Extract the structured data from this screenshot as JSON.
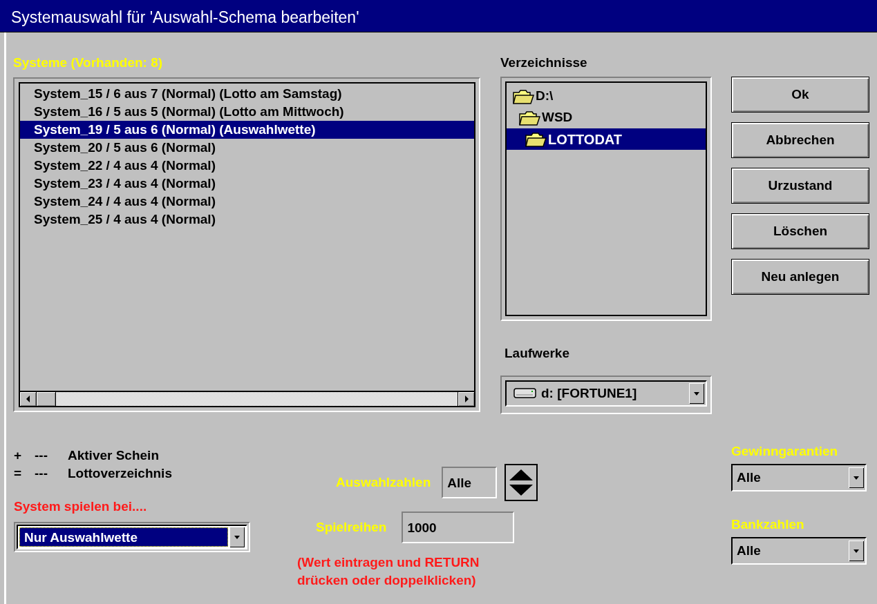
{
  "window": {
    "title": "Systemauswahl für 'Auswahl-Schema bearbeiten'"
  },
  "systems": {
    "label": "Systeme (Vorhanden: 8)",
    "items": [
      {
        "text": "System_15 / 6 aus 7 (Normal) (Lotto am Samstag)",
        "selected": false
      },
      {
        "text": "System_16 / 5 aus 5 (Normal) (Lotto am Mittwoch)",
        "selected": false
      },
      {
        "text": "System_19 / 5 aus 6 (Normal) (Auswahlwette)",
        "selected": true
      },
      {
        "text": "System_20 / 5 aus 6 (Normal)",
        "selected": false
      },
      {
        "text": "System_22 / 4 aus 4 (Normal)",
        "selected": false
      },
      {
        "text": "System_23 / 4 aus 4 (Normal)",
        "selected": false
      },
      {
        "text": "System_24 / 4 aus 4 (Normal)",
        "selected": false
      },
      {
        "text": "System_25 / 4 aus 4 (Normal)",
        "selected": false
      }
    ]
  },
  "directories": {
    "label": "Verzeichnisse",
    "tree": [
      {
        "name": "D:\\",
        "selected": false,
        "children": [
          {
            "name": "WSD",
            "selected": false,
            "children": [
              {
                "name": "LOTTODAT",
                "selected": true
              }
            ]
          }
        ]
      }
    ]
  },
  "drives": {
    "label": "Laufwerke",
    "value": "d: [FORTUNE1]"
  },
  "buttons": [
    "Ok",
    "Abbrechen",
    "Urzustand",
    "Löschen",
    "Neu anlegen"
  ],
  "legend": [
    {
      "symbol": "+",
      "dash": "---",
      "text": "Aktiver Schein"
    },
    {
      "symbol": "=",
      "dash": "---",
      "text": "Lottoverzeichnis"
    }
  ],
  "play_mode": {
    "label": "System spielen bei....",
    "value": "Nur Auswahlwette",
    "focused": true
  },
  "selection_numbers": {
    "label": "Auswahlzahlen",
    "value": "Alle"
  },
  "game_rows": {
    "label": "Spielreihen",
    "value": "1000"
  },
  "hint": [
    "(Wert eintragen und RETURN",
    "drücken oder doppelklicken)"
  ],
  "win_guarantees": {
    "label": "Gewinngarantien",
    "value": "Alle"
  },
  "bank_numbers": {
    "label": "Bankzahlen",
    "value": "Alle"
  }
}
